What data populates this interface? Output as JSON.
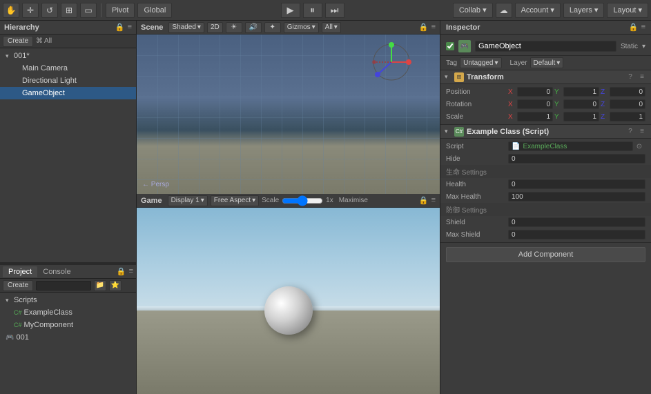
{
  "toolbar": {
    "hand_label": "✋",
    "move_label": "✛",
    "rotate_label": "↺",
    "scale_label": "⊞",
    "pivot_label": "Pivot",
    "global_label": "Global",
    "play_label": "▶",
    "pause_label": "⏸",
    "step_label": "⏭",
    "collab_label": "Collab ▾",
    "cloud_label": "☁",
    "account_label": "Account",
    "layers_label": "Layers",
    "layout_label": "Layout"
  },
  "hierarchy": {
    "title": "Hierarchy",
    "create_label": "Create",
    "all_label": "All",
    "root": "001*",
    "items": [
      {
        "label": "Main Camera",
        "indent": 1
      },
      {
        "label": "Directional Light",
        "indent": 1
      },
      {
        "label": "GameObject",
        "indent": 1,
        "selected": true
      }
    ]
  },
  "scene": {
    "title": "Scene",
    "shaded_label": "Shaded",
    "two_d_label": "2D",
    "gizmos_label": "Gizmos",
    "all_label": "All",
    "persp_label": "← Persp"
  },
  "game": {
    "title": "Game",
    "display_label": "Display 1",
    "aspect_label": "Free Aspect",
    "scale_label": "Scale",
    "scale_value": "1x",
    "maximise_label": "Maximise"
  },
  "project": {
    "title": "Project",
    "console_label": "Console",
    "create_label": "Create",
    "search_placeholder": "",
    "folders": [
      {
        "label": "Scripts",
        "items": [
          {
            "label": "ExampleClass",
            "icon": "C#"
          },
          {
            "label": "MyComponent",
            "icon": "C#"
          }
        ]
      }
    ],
    "assets": [
      {
        "label": "001",
        "icon": "🎮"
      }
    ]
  },
  "inspector": {
    "title": "Inspector",
    "gameobject_label": "GameObject",
    "static_label": "Static",
    "tag_label": "Tag",
    "tag_value": "Untagged",
    "layer_label": "Layer",
    "layer_value": "Default",
    "transform": {
      "title": "Transform",
      "position_label": "Position",
      "position": {
        "x": "0",
        "y": "1",
        "z": "0"
      },
      "rotation_label": "Rotation",
      "rotation": {
        "x": "0",
        "y": "0",
        "z": "0"
      },
      "scale_label": "Scale",
      "scale": {
        "x": "1",
        "y": "1",
        "z": "1"
      }
    },
    "script": {
      "title": "Example Class (Script)",
      "script_label": "Script",
      "script_value": "ExampleClass",
      "hide_label": "Hide",
      "hide_value": "0",
      "life_settings_label": "生命 Settings",
      "health_label": "Health",
      "health_value": "0",
      "max_health_label": "Max Health",
      "max_health_value": "100",
      "defense_settings_label": "防御 Settings",
      "shield_label": "Shield",
      "shield_value": "0",
      "max_shield_label": "Max Shield",
      "max_shield_value": "0"
    },
    "add_component_label": "Add Component"
  }
}
